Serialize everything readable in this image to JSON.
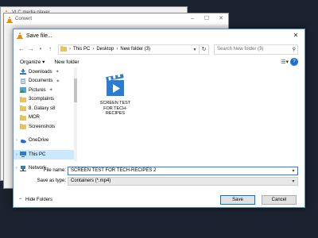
{
  "vlc_window": {
    "title": "VLC media player"
  },
  "convert_window": {
    "title": "Convert"
  },
  "dialog": {
    "title": "Save file...",
    "address": {
      "segments": [
        "This PC",
        "Desktop",
        "New folder (3)"
      ]
    },
    "search": {
      "placeholder": "Search New folder (3)"
    },
    "toolbar": {
      "organize": "Organize ▾",
      "new_folder": "New folder"
    },
    "nav": [
      {
        "label": "Downloads",
        "pinned": true,
        "icon": "downloads-icon"
      },
      {
        "label": "Documents",
        "pinned": true,
        "icon": "documents-icon"
      },
      {
        "label": "Pictures",
        "pinned": true,
        "icon": "pictures-icon"
      },
      {
        "label": "3complaints",
        "pinned": false,
        "icon": "folder-icon"
      },
      {
        "label": "8. Galaxy s8",
        "pinned": false,
        "icon": "folder-icon"
      },
      {
        "label": "MOR",
        "pinned": false,
        "icon": "folder-icon"
      },
      {
        "label": "Screenshots",
        "pinned": false,
        "icon": "folder-icon"
      },
      {
        "label": "OneDrive",
        "pinned": false,
        "icon": "onedrive-icon"
      },
      {
        "label": "This PC",
        "pinned": false,
        "icon": "this-pc-icon",
        "selected": true
      },
      {
        "label": "Network",
        "pinned": false,
        "icon": "network-icon"
      }
    ],
    "file": {
      "name": "SCREEN TEST FOR TECH-RECIPES"
    },
    "file_name_label": "File name:",
    "file_name_value": "SCREEN TEST FOR TECH-RECIPES 2",
    "save_type_label": "Save as type:",
    "save_type_value": "Containers (*.mp4)",
    "hide_folders": "Hide Folders",
    "save_label": "Save",
    "cancel_label": "Cancel"
  },
  "colors": {
    "accent": "#0078d7",
    "desktop": "#1b2330",
    "folder": "#e8c35a",
    "selected": "#cce8ff"
  }
}
